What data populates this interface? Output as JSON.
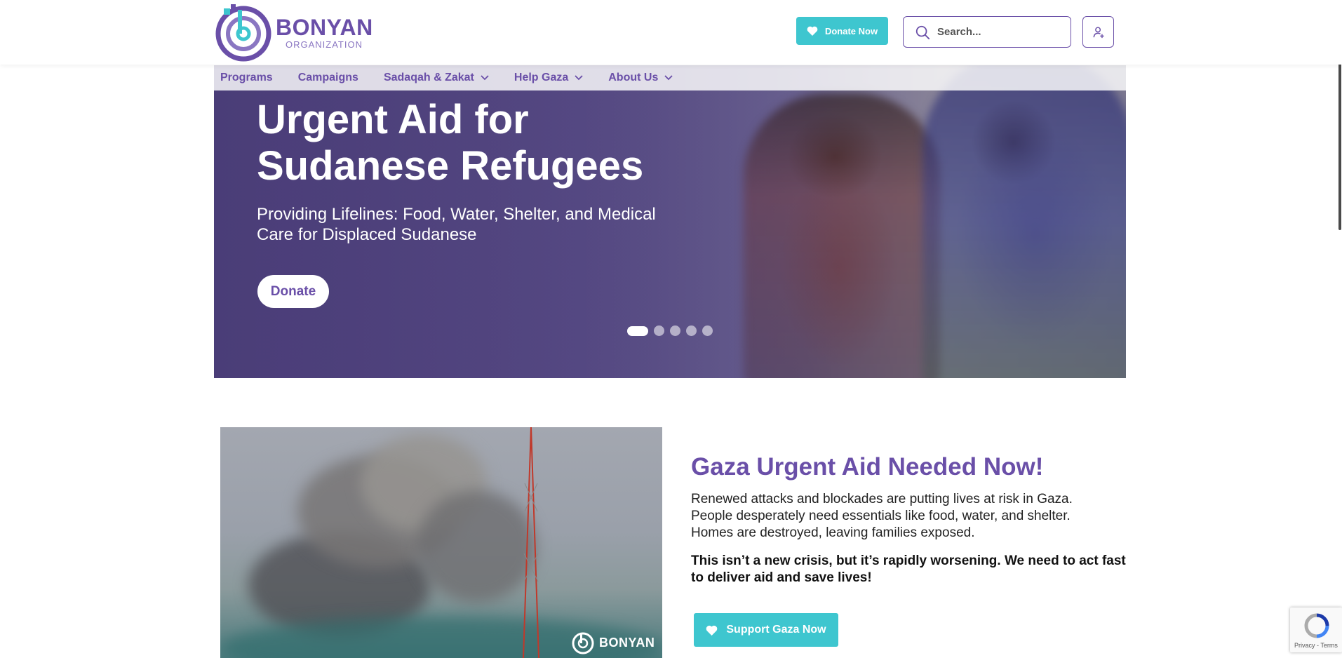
{
  "header": {
    "logo_name": "BONYAN",
    "logo_sub": "ORGANIZATION",
    "donate_label": "Donate Now",
    "search_placeholder": "Search...",
    "accent_color": "#6a4fa8",
    "teal_color": "#3ec6cf"
  },
  "nav": {
    "items": [
      {
        "label": "Programs",
        "dropdown": false
      },
      {
        "label": "Campaigns",
        "dropdown": false
      },
      {
        "label": "Sadaqah & Zakat",
        "dropdown": true
      },
      {
        "label": "Help Gaza",
        "dropdown": true
      },
      {
        "label": "About Us",
        "dropdown": true
      }
    ]
  },
  "hero": {
    "title": "Urgent Aid for Sudanese Refugees",
    "subtitle": "Providing Lifelines: Food, Water, Shelter, and Medical Care for Displaced Sudanese",
    "button_label": "Donate",
    "slide_count": 5,
    "active_slide": 1
  },
  "gaza": {
    "title": "Gaza Urgent Aid Needed Now!",
    "body": "Renewed attacks and blockades are putting lives at risk in Gaza. People desperately need essentials like food, water, and shelter. Homes are destroyed, leaving families exposed.",
    "bold": "This isn’t a new crisis, but it’s rapidly worsening. We need to act fast to deliver aid and save lives!",
    "button_label": "Support Gaza Now",
    "watermark_text": "BONYAN"
  },
  "recaptcha": {
    "text": "Privacy - Terms"
  }
}
